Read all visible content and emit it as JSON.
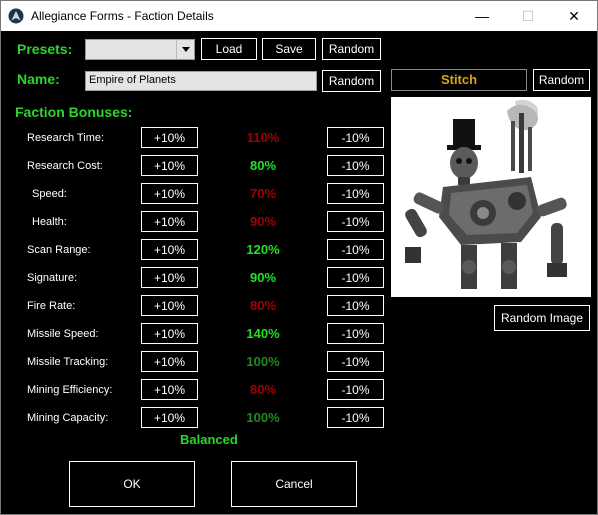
{
  "window": {
    "title": "Allegiance Forms - Faction Details",
    "minimize": "—",
    "maximize": "☐",
    "close": "✕"
  },
  "presets": {
    "label": "Presets:",
    "value": "",
    "load": "Load",
    "save": "Save",
    "random": "Random"
  },
  "name": {
    "label": "Name:",
    "value": "Empire of Planets",
    "random": "Random"
  },
  "bonuses": {
    "heading": "Faction Bonuses:",
    "plus_label": "+10%",
    "minus_label": "-10%",
    "rows": [
      {
        "label": "Research Time:",
        "value": "110%",
        "color": "red"
      },
      {
        "label": "Research Cost:",
        "value": "80%",
        "color": "bright"
      },
      {
        "label": "Speed:",
        "value": "70%",
        "color": "red"
      },
      {
        "label": "Health:",
        "value": "90%",
        "color": "red"
      },
      {
        "label": "Scan Range:",
        "value": "120%",
        "color": "bright"
      },
      {
        "label": "Signature:",
        "value": "90%",
        "color": "bright"
      },
      {
        "label": "Fire Rate:",
        "value": "80%",
        "color": "red"
      },
      {
        "label": "Missile Speed:",
        "value": "140%",
        "color": "bright"
      },
      {
        "label": "Missile Tracking:",
        "value": "100%",
        "color": "dark"
      },
      {
        "label": "Mining Efficiency:",
        "value": "80%",
        "color": "red"
      },
      {
        "label": "Mining Capacity:",
        "value": "100%",
        "color": "dark"
      }
    ],
    "status": "Balanced"
  },
  "portrait": {
    "name": "Stitch",
    "random": "Random",
    "random_image": "Random Image"
  },
  "footer": {
    "ok": "OK",
    "cancel": "Cancel"
  },
  "colors": {
    "green": "#2cd52c",
    "bright_value": "#22e022",
    "dark_value": "#1e8a1e",
    "red_value": "#a00000",
    "name_gold": "#d9a514"
  }
}
